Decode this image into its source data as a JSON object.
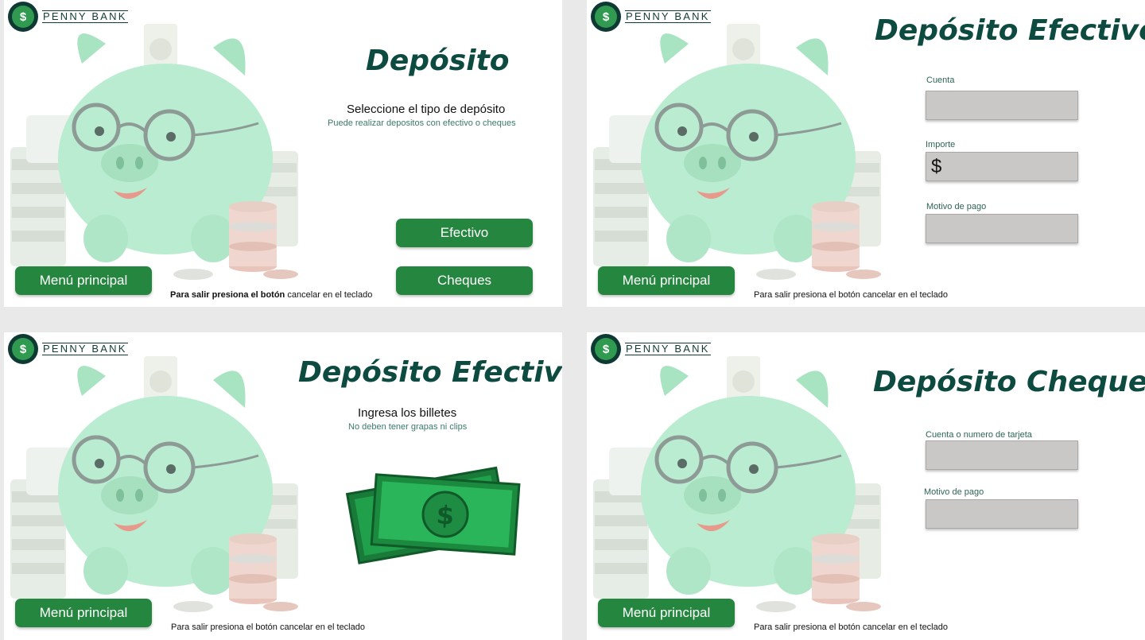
{
  "brand": {
    "name": "PENNY BANK",
    "logo_glyph": "$"
  },
  "colors": {
    "primary_button": "#25873f",
    "title": "#0d4a40",
    "field": "#c9c8c6",
    "logo_dark": "#0e3a33"
  },
  "screens": {
    "deposit": {
      "title": "Depósito",
      "prompt": "Seleccione el tipo de depósito",
      "hint": "Puede realizar depositos con efectivo o cheques",
      "cash_button": "Efectivo",
      "checks_button": "Cheques",
      "menu_button": "Menú principal",
      "exit_bold": "Para salir presiona el botón",
      "exit_rest": "cancelar en el teclado"
    },
    "cash_form": {
      "title": "Depósito Efectivo",
      "account_label": "Cuenta",
      "amount_label": "Importe",
      "amount_prefix": "$",
      "reason_label": "Motivo de pago",
      "menu_button": "Menú principal",
      "exit_note": "Para salir presiona el botón cancelar en el teclado"
    },
    "cash_insert": {
      "title": "Depósito Efectivo",
      "prompt": "Ingresa los billetes",
      "hint": "No deben tener grapas ni clips",
      "bill_icon": "dollar-bills-icon",
      "menu_button": "Menú principal",
      "exit_note": "Para salir presiona el botón cancelar en el teclado"
    },
    "checks_form": {
      "title": "Depósito Cheques",
      "account_label": "Cuenta o numero de tarjeta",
      "reason_label": "Motivo de pago",
      "menu_button": "Menú principal",
      "exit_note": "Para salir presiona el botón cancelar en el teclado"
    }
  }
}
